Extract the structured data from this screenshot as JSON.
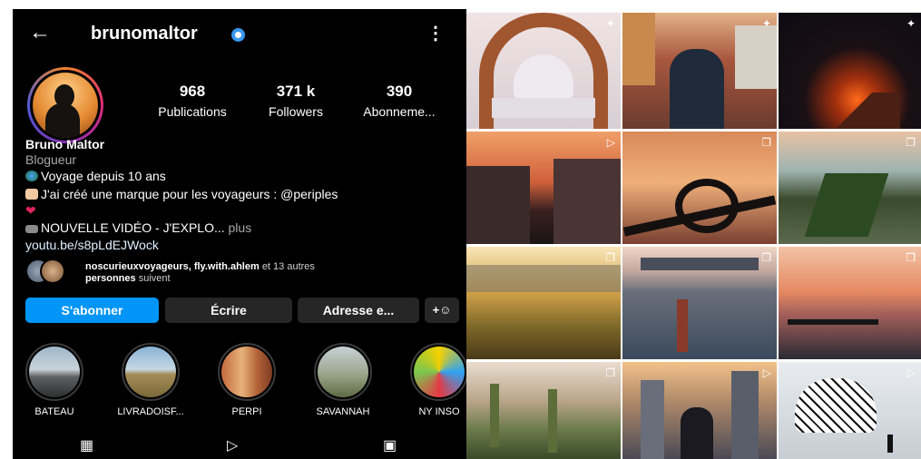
{
  "header": {
    "back_icon": "arrow-left-icon",
    "username": "brunomaltor",
    "verified_icon": "verified-badge-icon",
    "menu_icon": "more-vertical-icon"
  },
  "stats": [
    {
      "value": "968",
      "label": "Publications"
    },
    {
      "value": "371 k",
      "label": "Followers"
    },
    {
      "value": "390",
      "label": "Abonneme..."
    }
  ],
  "bio": {
    "name": "Bruno Maltor",
    "category": "Blogueur",
    "line1": "Voyage depuis 10 ans",
    "line2": "J'ai créé une marque pour les voyageurs : @periples",
    "line3": "NOUVELLE VIDÉO - J'EXPLO...",
    "more": "plus",
    "link": "youtu.be/s8pLdEJWock"
  },
  "followed_by": {
    "names": "noscurieuxvoyageurs, fly.with.ahlem",
    "rest": "et 13 autres",
    "line2_bold": "personnes",
    "line2_rest": "suivent"
  },
  "buttons": {
    "follow": "S'abonner",
    "message": "Écrire",
    "address": "Adresse e...",
    "suggest_icon": "add-person-icon"
  },
  "highlights": [
    {
      "label": "BATEAU"
    },
    {
      "label": "LIVRADOISF..."
    },
    {
      "label": "PERPI"
    },
    {
      "label": "SAVANNAH"
    },
    {
      "label": "NY INSO"
    }
  ],
  "tabs": [
    {
      "icon": "grid-icon"
    },
    {
      "icon": "reels-icon"
    },
    {
      "icon": "tagged-icon"
    }
  ],
  "colors": {
    "accent": "#0095f6",
    "background": "#000000",
    "secondary_button": "#262626"
  },
  "posts": [
    {
      "subject": "Taj Mahal",
      "badge_icon": "pin-icon"
    },
    {
      "subject": "Man on rooftops",
      "badge_icon": "pin-icon"
    },
    {
      "subject": "Volcano at night",
      "badge_icon": "pin-icon"
    },
    {
      "subject": "Street at sunset",
      "badge_icon": "reel-icon"
    },
    {
      "subject": "Roller coaster sunset",
      "badge_icon": "carousel-icon"
    },
    {
      "subject": "Central Park aerial",
      "badge_icon": "carousel-icon"
    },
    {
      "subject": "Field at golden hour",
      "badge_icon": "carousel-icon"
    },
    {
      "subject": "Person by river",
      "badge_icon": "carousel-icon"
    },
    {
      "subject": "Lake pier",
      "badge_icon": "carousel-icon"
    },
    {
      "subject": "Cactus garden",
      "badge_icon": "carousel-icon"
    },
    {
      "subject": "City skyline",
      "badge_icon": "reel-icon"
    },
    {
      "subject": "White sculpture",
      "badge_icon": "reel-icon"
    }
  ]
}
